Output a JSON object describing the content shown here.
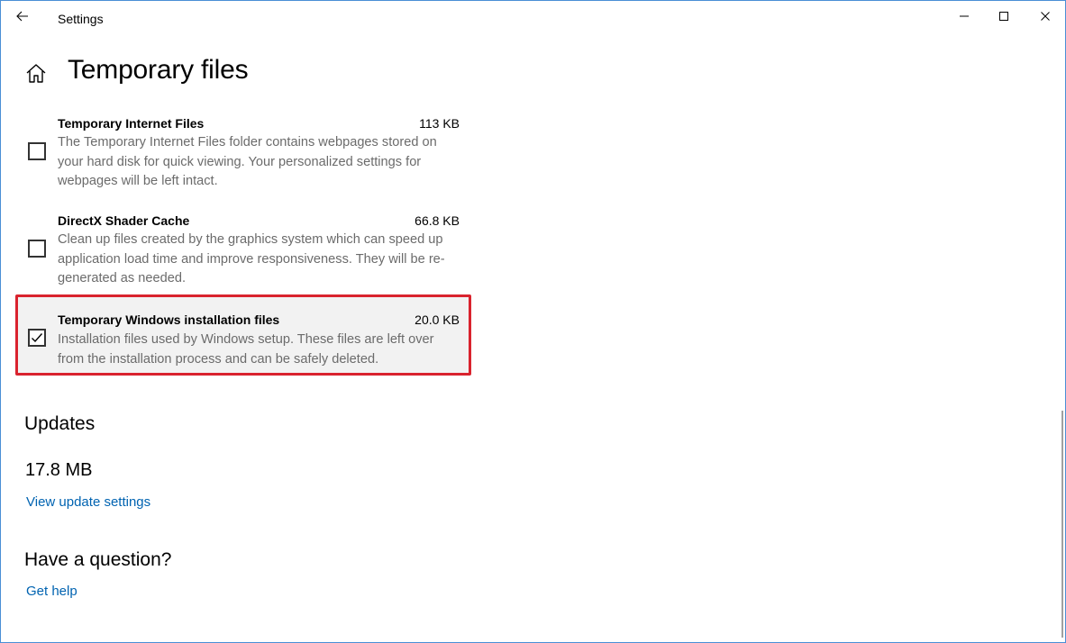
{
  "window": {
    "title": "Settings"
  },
  "header": {
    "title": "Temporary files"
  },
  "files": [
    {
      "name": "Temporary Internet Files",
      "size": "113 KB",
      "description": "The Temporary Internet Files folder contains webpages stored on your hard disk for quick viewing. Your personalized settings for webpages will be left intact.",
      "checked": false
    },
    {
      "name": "DirectX Shader Cache",
      "size": "66.8 KB",
      "description": "Clean up files created by the graphics system which can speed up application load time and improve responsiveness. They will be re-generated as needed.",
      "checked": false
    },
    {
      "name": "Temporary Windows installation files",
      "size": "20.0 KB",
      "description": "Installation files used by Windows setup.  These files are left over from the installation process and can be safely deleted.",
      "checked": true,
      "highlighted": true
    }
  ],
  "updates": {
    "title": "Updates",
    "size": "17.8 MB",
    "link": "View update settings"
  },
  "help": {
    "title": "Have a question?",
    "link": "Get help"
  },
  "colors": {
    "accent": "#0063b1",
    "highlight_border": "#d9232e",
    "window_border": "#4a8fd6"
  }
}
